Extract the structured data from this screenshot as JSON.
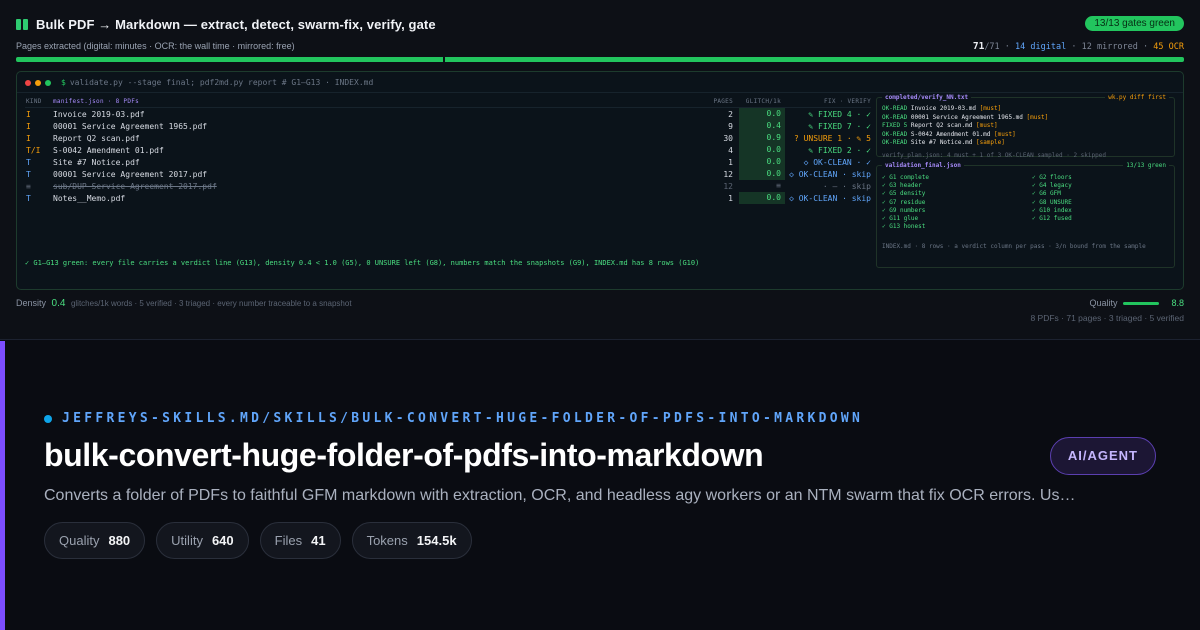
{
  "header": {
    "title": "Bulk PDF → Markdown — extract, detect, swarm-fix, verify, gate",
    "gates_badge": "13/13 gates green",
    "subtitle": "Pages extracted (digital: minutes · OCR: the wall time · mirrored: free)",
    "pages_done": "71",
    "pages_total": "/71",
    "digital": "14 digital",
    "mirrored": "12 mirrored",
    "ocr": "45 OCR",
    "sep": "·"
  },
  "colors": {
    "accent_green": "#22c55e",
    "accent_purple": "#7c4dff",
    "accent_blue": "#60a5fa",
    "warn_orange": "#f59e0b"
  },
  "terminal": {
    "command": "validate.py --stage final; pdf2md.py report # G1–G13 · INDEX.md",
    "prompt": "$",
    "columns": {
      "kind": "KIND",
      "manifest": "manifest.json · 8 PDFs",
      "pages": "PAGES",
      "glitch": "GLITCH/1k",
      "verdict": "FIX · VERIFY"
    },
    "rows": [
      {
        "kind": "I",
        "kind_class": "kind-I",
        "name": "Invoice 2019-03.pdf",
        "pages": "2",
        "glitch": "0.0",
        "verdict": "✎ FIXED 4 · ✓",
        "v_class": "v-fixed",
        "strike": false
      },
      {
        "kind": "I",
        "kind_class": "kind-I",
        "name": "00001 Service Agreement 1965.pdf",
        "pages": "9",
        "glitch": "0.4",
        "verdict": "✎ FIXED 7 · ✓",
        "v_class": "v-fixed",
        "strike": false
      },
      {
        "kind": "I",
        "kind_class": "kind-I",
        "name": "Report Q2 scan.pdf",
        "pages": "30",
        "glitch": "0.9",
        "verdict": "? UNSURE 1 · ✎ 5",
        "v_class": "v-unsure",
        "strike": false
      },
      {
        "kind": "T/I",
        "kind_class": "kind-TI",
        "name": "S-0042 Amendment 01.pdf",
        "pages": "4",
        "glitch": "0.0",
        "verdict": "✎ FIXED 2 · ✓",
        "v_class": "v-fixed",
        "strike": false
      },
      {
        "kind": "T",
        "kind_class": "kind-T",
        "name": "Site #7 Notice.pdf",
        "pages": "1",
        "glitch": "0.0",
        "verdict": "◇ OK-CLEAN · ✓",
        "v_class": "v-clean",
        "strike": false
      },
      {
        "kind": "T",
        "kind_class": "kind-T",
        "name": "00001 Service Agreement 2017.pdf",
        "pages": "12",
        "glitch": "0.0",
        "verdict": "◇ OK-CLEAN · skip",
        "v_class": "v-clean",
        "strike": false
      },
      {
        "kind": "≡",
        "kind_class": "kind-D",
        "name": "sub/DUP Service Agreement 2017.pdf",
        "pages": "12",
        "glitch": "≡",
        "verdict": "· — · skip",
        "v_class": "v-skip",
        "strike": true
      },
      {
        "kind": "T",
        "kind_class": "kind-T",
        "name": "Notes__Memo.pdf",
        "pages": "1",
        "glitch": "0.0",
        "verdict": "◇ OK-CLEAN · skip",
        "v_class": "v-clean",
        "strike": false
      }
    ],
    "summary": "✓ G1–G13 green: every file carries a verdict line (G13), density 0.4 < 1.0 (G5), 0 UNSURE left (G8), numbers match the snapshots (G9), INDEX.md has 8 rows (G10)"
  },
  "verify_panel": {
    "title": "completed/verify_NN.txt",
    "right": "wk.py diff first",
    "lines": [
      {
        "k": "OK-READ",
        "text": "Invoice 2019-03.md",
        "tag": "[must]"
      },
      {
        "k": "OK-READ",
        "text": "00001 Service Agreement 1965.md",
        "tag": "[must]"
      },
      {
        "k": "FIXED 5",
        "text": "Report Q2 scan.md",
        "tag": "[must]"
      },
      {
        "k": "OK-READ",
        "text": "S-0042 Amendment 01.md",
        "tag": "[must]"
      },
      {
        "k": "OK-READ",
        "text": "Site #7 Notice.md",
        "tag": "[sample]"
      }
    ],
    "footer": "verify_plan.json: 4 must + 1 of 3 OK-CLEAN sampled · 2 skipped"
  },
  "validation_panel": {
    "title": "validation_final.json",
    "right": "13/13 green",
    "gates": [
      "✓ G1 complete",
      "✓ G2 floors",
      "✓ G3 header",
      "✓ G4 legacy",
      "✓ G5 density",
      "✓ G6 GFM",
      "✓ G7 residue",
      "✓ G8 UNSURE",
      "✓ G9 numbers",
      "✓ G10 index",
      "✓ G11 glue",
      "✓ G12 fused",
      "✓ G13 honest"
    ],
    "footer": "INDEX.md · 8 rows · a verdict column per pass · 3/n bound from the sample"
  },
  "footer_stats": {
    "density_label": "Density",
    "density_value": "0.4",
    "density_rest": "glitches/1k words · 5 verified · 3 triaged · every number traceable to a snapshot",
    "quality_label": "Quality",
    "quality_value": "8.8",
    "quality_fraction": 0.88,
    "totals": "8 PDFs · 71 pages · 3 triaged · 5 verified"
  },
  "card": {
    "path": "JEFFREYS-SKILLS.MD/SKILLS/BULK-CONVERT-HUGE-FOLDER-OF-PDFS-INTO-MARKDOWN",
    "title": "bulk-convert-huge-folder-of-pdfs-into-markdown",
    "category": "AI/AGENT",
    "description": "Converts a folder of PDFs to faithful GFM markdown with extraction, OCR, and headless agy workers or an NTM swarm that fix OCR errors. Us…",
    "stats": [
      {
        "label": "Quality",
        "value": "880"
      },
      {
        "label": "Utility",
        "value": "640"
      },
      {
        "label": "Files",
        "value": "41"
      },
      {
        "label": "Tokens",
        "value": "154.5k"
      }
    ]
  }
}
